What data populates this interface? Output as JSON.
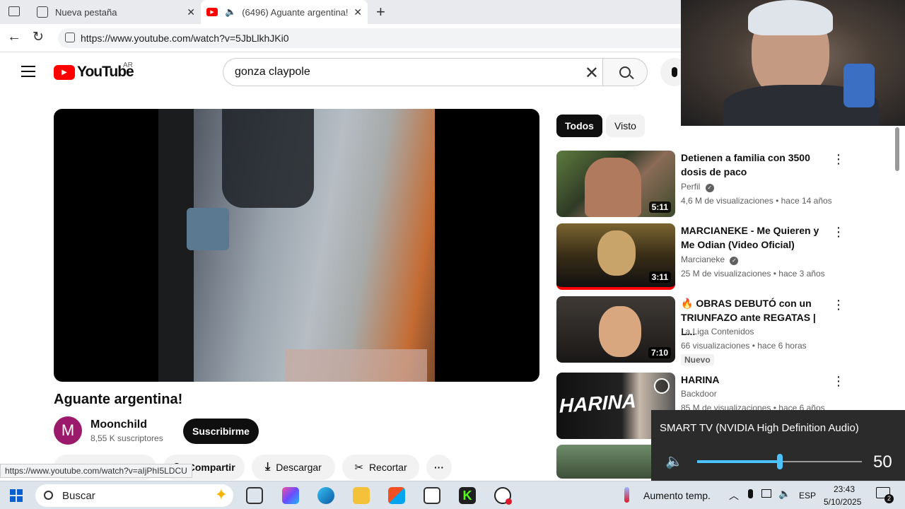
{
  "browser": {
    "tabs": [
      {
        "label": "Nueva pestaña"
      },
      {
        "label": "(6496) Aguante argentina! -"
      }
    ],
    "url": "https://www.youtube.com/watch?v=5JbLlkhJKi0",
    "status_url": "https://www.youtube.com/watch?v=aIjPhI5LDCU"
  },
  "youtube": {
    "logo_text": "YouTube",
    "region": "AR",
    "search_value": "gonza claypole",
    "video": {
      "title": "Aguante argentina!",
      "channel": "Moonchild",
      "channel_initial": "M",
      "subscribers": "8,55 K suscriptores",
      "subscribe_label": "Suscribirme",
      "actions": [
        "Compartir",
        "Descargar",
        "Recortar"
      ],
      "more_label": "···"
    },
    "chips": [
      "Todos",
      "Visto"
    ],
    "recommendations": [
      {
        "title": "Detienen a familia con 3500 dosis de paco",
        "channel": "Perfil",
        "verified": true,
        "meta": "4,6 M de visualizaciones • hace 14 años",
        "duration": "5:11",
        "badge": ""
      },
      {
        "title": "MARCIANEKE - Me Quieren y Me Odian (Video Oficial)",
        "channel": "Marcianeke",
        "verified": true,
        "meta": "25 M de visualizaciones • hace 3 años",
        "duration": "3:11",
        "badge": ""
      },
      {
        "title": "🔥 OBRAS DEBUTÓ con un TRIUNFAZO ante REGATAS | L...",
        "channel": "La Liga Contenidos",
        "verified": false,
        "meta": "66 visualizaciones • hace 6 horas",
        "duration": "7:10",
        "badge": "Nuevo"
      },
      {
        "title": "HARINA",
        "channel": "Backdoor",
        "verified": false,
        "meta": "85 M de visualizaciones • hace 6 años",
        "duration": "",
        "badge": "",
        "thumb_text": "HARINA"
      }
    ]
  },
  "volume_flyout": {
    "device": "SMART TV (NVIDIA High Definition Audio)",
    "level": 50
  },
  "taskbar": {
    "search_placeholder": "Buscar",
    "weather": "Aumento temp.",
    "language": "ESP",
    "time": "23:43",
    "date": "5/10/2025",
    "notifications": "2"
  },
  "colors": {
    "yt_red": "#ff0000",
    "accent": "#4cc2ff",
    "subscribe_bg": "#0f0f0f"
  }
}
